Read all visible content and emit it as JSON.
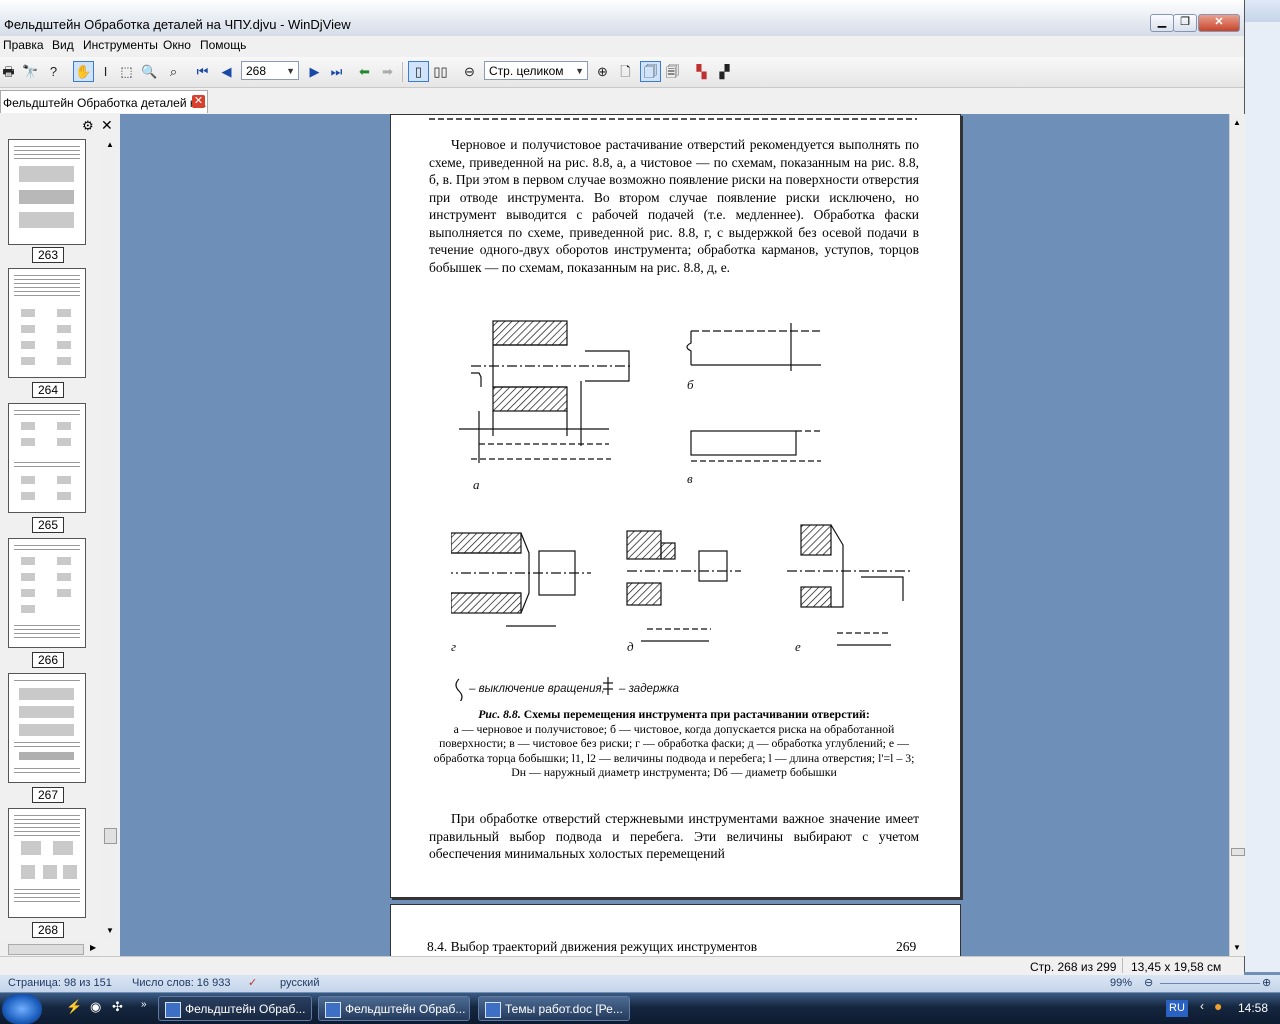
{
  "window": {
    "title": "Фельдштейн Обработка деталей на ЧПУ.djvu - WinDjView",
    "buttons": {
      "minimize": "▁",
      "maximize": "❐",
      "close": "✕"
    }
  },
  "menu": [
    "Правка",
    "Вид",
    "Инструменты",
    "Окно",
    "Помощь"
  ],
  "toolbar": {
    "page_number": "268",
    "zoom": "Стр. целиком"
  },
  "tab": {
    "label": "Фельдштейн Обработка деталей н..."
  },
  "sidebar": {
    "thumbnails": [
      "263",
      "264",
      "265",
      "266",
      "267",
      "268"
    ]
  },
  "page": {
    "para1": "Черновое и получистовое растачивание отверстий рекомендуется выполнять по схеме, приведенной на рис. 8.8, а, а чистовое — по схемам, показанным на рис. 8.8, б, в. При этом в первом случае возможно появление риски на поверхности отверстия при отводе инструмента. Во втором случае появление риски исключено, но инструмент выводится с рабочей подачей (т.е. медленнее). Обработка фаски выполняется по схеме, приведенной рис. 8.8, г, с выдержкой без осевой подачи в течение одного-двух оборотов инструмента; обработка карманов, уступов, торцов бобышек — по схемам, показанным на рис. 8.8, д, е.",
    "figure_labels": {
      "a": "а",
      "b": "б",
      "v": "в",
      "g": "г",
      "d": "д",
      "e": "е"
    },
    "legend": {
      "rotation_off": "– выключение вращения,",
      "delay": "– задержка"
    },
    "caption": {
      "title": "Рис. 8.8.",
      "title_text": "Схемы перемещения инструмента при растачивании отверстий:",
      "body": "а — черновое и получистовое; б — чистовое, когда допускается риска на обработанной поверхности; в — чистовое без риски; г — обработка фаски; д — обработка углублений; е — обработка торца бобышки; l1, l2 — величины подвода и перебега; l — длина отверстия; l'=l – 3; Dн — наружный диаметр инструмента; Dб — диаметр бобышки"
    },
    "para2": "При обработке отверстий стержневыми инструментами важное значение имеет правильный выбор подвода и перебега. Эти величины выбирают с учетом обеспечения минимальных холостых перемещений",
    "next_page_header": "8.4. Выбор траекторий движения режущих инструментов",
    "next_page_number": "269"
  },
  "status": {
    "page_of": "Стр. 268 из 299",
    "size": "13,45 x 19,58 см"
  },
  "word_status": {
    "page": "Страница: 98 из 151",
    "words": "Число слов: 16 933",
    "language": "русский",
    "zoom": "99%"
  },
  "taskbar": {
    "tasks": [
      "Фельдштейн Обраб...",
      "Фельдштейн Обраб...",
      "Темы работ.doc [Ре..."
    ],
    "lang": "RU",
    "time": "14:58"
  },
  "colors": {
    "viewer_bg": "#6e8fb8",
    "taskbar": "#15263f",
    "close": "#d6402d"
  }
}
